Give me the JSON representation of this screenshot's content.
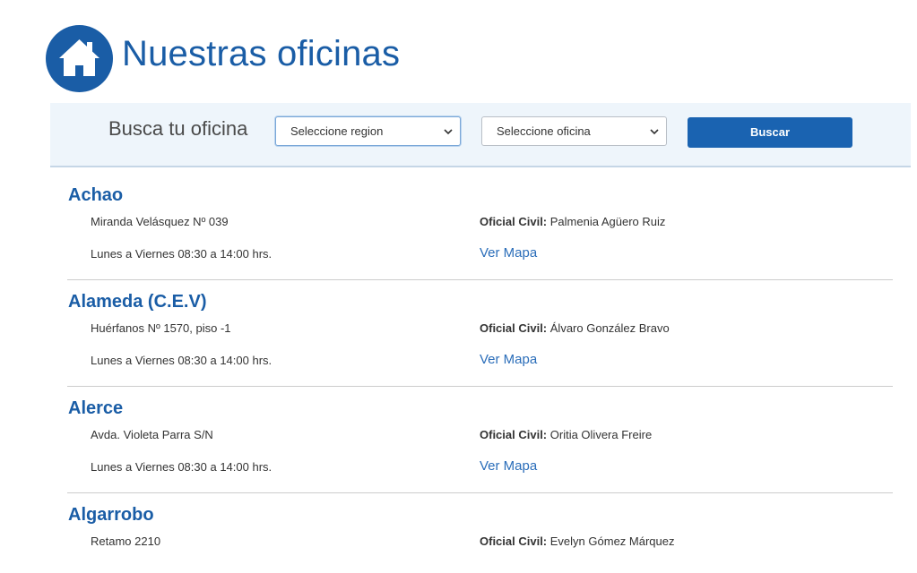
{
  "header": {
    "icon": "home-icon",
    "title": "Nuestras oficinas"
  },
  "search": {
    "label": "Busca tu oficina",
    "region_select": "Seleccione region",
    "office_select": "Seleccione oficina",
    "button": "Buscar"
  },
  "offices": [
    {
      "name": "Achao",
      "address": "Miranda Velásquez Nº 039",
      "hours": "Lunes a Viernes 08:30 a 14:00 hrs.",
      "official_label": "Oficial Civil:",
      "official_name": "Palmenia Agüero Ruiz",
      "map_link": "Ver Mapa"
    },
    {
      "name": "Alameda (C.E.V)",
      "address": "Huérfanos Nº 1570, piso -1",
      "hours": "Lunes a Viernes 08:30 a 14:00 hrs.",
      "official_label": "Oficial Civil:",
      "official_name": "Álvaro González Bravo",
      "map_link": "Ver Mapa"
    },
    {
      "name": "Alerce",
      "address": "Avda. Violeta Parra S/N",
      "hours": "Lunes a Viernes 08:30 a 14:00 hrs.",
      "official_label": "Oficial Civil:",
      "official_name": "Oritia Olivera Freire",
      "map_link": "Ver Mapa"
    },
    {
      "name": "Algarrobo",
      "address": "Retamo 2210",
      "hours": "",
      "official_label": "Oficial Civil:",
      "official_name": "Evelyn Gómez Márquez",
      "map_link": ""
    }
  ],
  "colors": {
    "brand_blue": "#1a5da6",
    "button_blue": "#1a63b1",
    "link_blue": "#2a6db9",
    "search_bg": "#eef5fb"
  }
}
